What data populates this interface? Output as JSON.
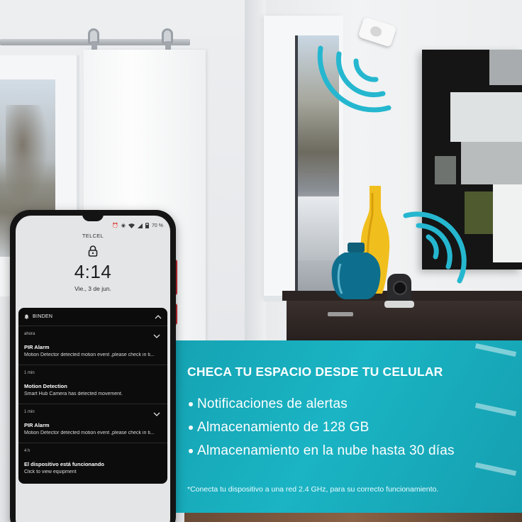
{
  "phone": {
    "status": {
      "battery": "70 %"
    },
    "carrier": "TELCEL",
    "time": "4:14",
    "date": "Vie., 3 de jun.",
    "app_name": "BINDEN",
    "notifications": [
      {
        "time": "ahora",
        "title": "PIR Alarm",
        "body": "Motion Detector detected motion event ,please check in ti..."
      },
      {
        "time": "1 min",
        "title": "Motion Detection",
        "body": "Smart Hub Camera has detected movement."
      },
      {
        "time": "1 min",
        "title": "PIR Alarm",
        "body": "Motion Detector detected motion event ,please check in ti..."
      },
      {
        "time": "4 h",
        "title": "El dispositivo está funcionando",
        "body": "Click to view equipment"
      }
    ]
  },
  "banner": {
    "headline": "CHECA TU ESPACIO DESDE TU CELULAR",
    "features": [
      "Notificaciones de alertas",
      "Almacenamiento de 128 GB",
      "Almacenamiento en la nube hasta 30 días"
    ],
    "footnote": "*Conecta tu dispositivo a una red 2.4 GHz, para su correcto funcionamiento.",
    "color": "#1ab4c4"
  },
  "icons": [
    "lock-icon",
    "bell-icon",
    "chevron-up-icon",
    "chevron-down-icon",
    "wifi-icon",
    "battery-icon",
    "motion-sensor-icon",
    "signal-wave-icon"
  ]
}
